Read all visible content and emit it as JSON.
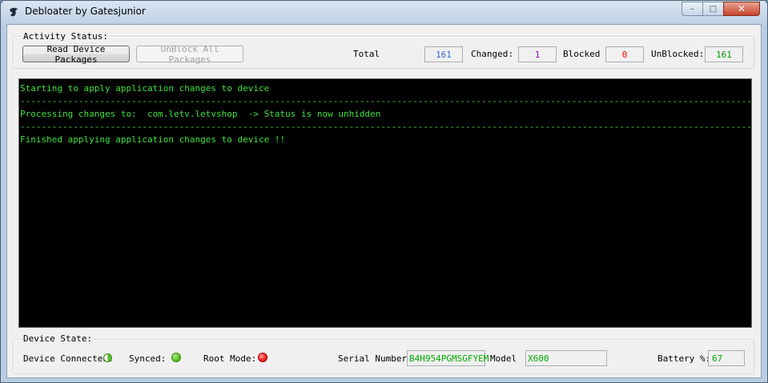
{
  "window": {
    "title": "Debloater by Gatesjunior",
    "minimize_glyph": "–",
    "maximize_glyph": "□",
    "close_glyph": "✕"
  },
  "activity": {
    "group_label": "Activity Status:",
    "read_button": "Read Device Packages",
    "unblock_button": "UnBlock All Packages",
    "total_label": "Total",
    "total_value": "161",
    "changed_label": "Changed:",
    "changed_value": "1",
    "blocked_label": "Blocked",
    "blocked_value": "0",
    "unblocked_label": "UnBlocked:",
    "unblocked_value": "161"
  },
  "console": {
    "lines": [
      "Starting to apply application changes to device",
      "--------------------------------------------------------------------------------------------------------------------------------------------------------------------------------------------------------------------------------------------------",
      "Processing changes to:  com.letv.letvshop  -> Status is now unhidden",
      "--------------------------------------------------------------------------------------------------------------------------------------------------------------------------------------------------------------------------------------------------",
      "Finished applying application changes to device !!"
    ]
  },
  "device": {
    "group_label": "Device State:",
    "connected_label": "Device Connected:",
    "synced_label": "Synced:",
    "root_label": "Root Mode:",
    "serial_label": "Serial Number:",
    "serial_value": "B4H954PGMSGFYEM",
    "model_label": "Model",
    "model_value": "X600",
    "battery_label": "Battery %:",
    "battery_value": "67"
  },
  "colors": {
    "console_text": "#3ee03e",
    "total": "#3366cc",
    "changed": "#9900cc",
    "blocked": "#ff0000",
    "unblocked": "#009900",
    "serial": "#00aa00",
    "synced_dot": "#55c023",
    "root_dot": "#ff1a1a",
    "connected_dot": "#55c023"
  },
  "icons": {
    "app": "debloater-app-icon",
    "connected": "half-green-dot-icon",
    "synced": "green-dot-icon",
    "root": "red-dot-icon"
  }
}
